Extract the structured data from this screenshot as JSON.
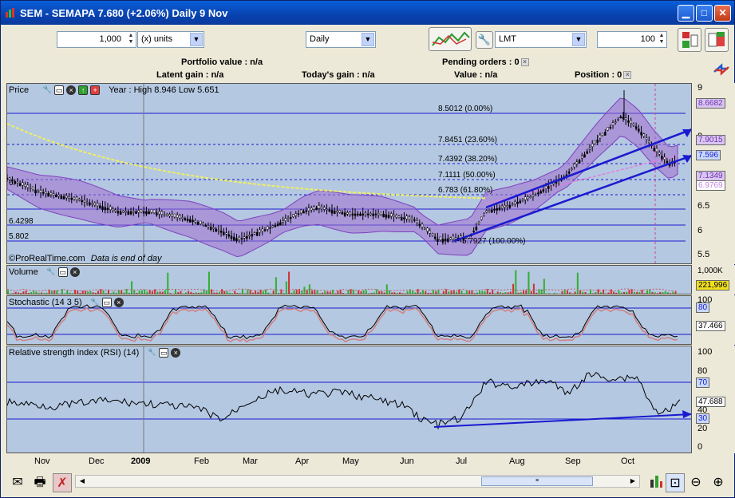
{
  "window": {
    "title": "SEM - SEMAPA     7.680  (+2.06%)     Daily  9 Nov",
    "min_icon": "minimize-icon",
    "max_icon": "maximize-icon",
    "close_icon": "close-icon"
  },
  "toolbar": {
    "quantity": "1,000",
    "units": "(x) units",
    "period": "Daily",
    "order_type": "LMT",
    "order_qty": "100"
  },
  "info": {
    "portfolio_value": "Portfolio value : n/a",
    "pending_orders": "Pending orders : 0",
    "latent_gain": "Latent gain : n/a",
    "todays_gain": "Today's gain : n/a",
    "value": "Value : n/a",
    "position": "Position : 0"
  },
  "price_panel": {
    "title": "Price",
    "year_info": "Year : High 8.946 Low 5.651",
    "footer": "©ProRealTime.com",
    "footer_note": "Data is end of day",
    "fib": [
      {
        "label": "8.5012 (0.00%)"
      },
      {
        "label": "7.8451 (23.60%)"
      },
      {
        "label": "7.4392 (38.20%)"
      },
      {
        "label": "7.1111 (50.00%)"
      },
      {
        "label": "6.783 (61.80%)"
      },
      {
        "label": "5.7927 (100.00%)"
      }
    ],
    "left_labels": [
      "6.",
      "6.4298",
      "5.802"
    ],
    "axis": [
      "9",
      "8.6682",
      "8",
      "7.9015",
      "7.596",
      "7.1349",
      "6.9769",
      "6.5",
      "6",
      "5.5"
    ]
  },
  "volume_panel": {
    "title": "Volume",
    "axis": [
      "1,000K",
      "221,996"
    ]
  },
  "stoch_panel": {
    "title": "Stochastic (14 3 5)",
    "axis": [
      "100",
      "80",
      "37.466"
    ]
  },
  "rsi_panel": {
    "title": "Relative strength index (RSI) (14)",
    "axis": [
      "100",
      "80",
      "70",
      "47.688",
      "40",
      "30",
      "20",
      "0"
    ]
  },
  "dates": [
    "Nov",
    "Dec",
    "2009",
    "Feb",
    "Mar",
    "Apr",
    "May",
    "Jun",
    "Jul",
    "Aug",
    "Sep",
    "Oct"
  ],
  "colors": {
    "panel_bg": "#b4c8e1",
    "candle": "#000000",
    "bollinger": "#9c4fd0",
    "ma": "#f0f060",
    "trend": "#1a1ad0"
  }
}
